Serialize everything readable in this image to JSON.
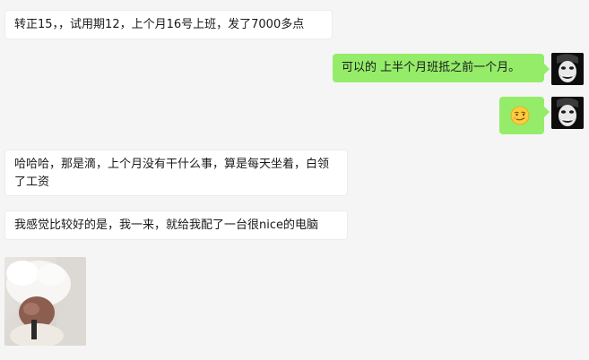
{
  "messages": [
    {
      "side": "in",
      "text": "转正15，，试用期12，上个月16号上班，发了7000多点"
    },
    {
      "side": "out",
      "text": "可以的 上半个月班抵之前一个月。"
    },
    {
      "side": "out",
      "emoji": "smirk-face-emoji"
    },
    {
      "side": "in",
      "text": "哈哈哈，那是滴，上个月没有干什么事，算是每天坐着，白领了工资"
    },
    {
      "side": "in",
      "text": "我感觉比较好的是，我一来，就给我配了一台很nice的电脑"
    },
    {
      "side": "in",
      "image": "fluffy-pet-photo"
    }
  ],
  "colors": {
    "background": "#f5f5f5",
    "incoming_bubble": "#ffffff",
    "outgoing_bubble": "#95ec69",
    "text": "#191919"
  }
}
